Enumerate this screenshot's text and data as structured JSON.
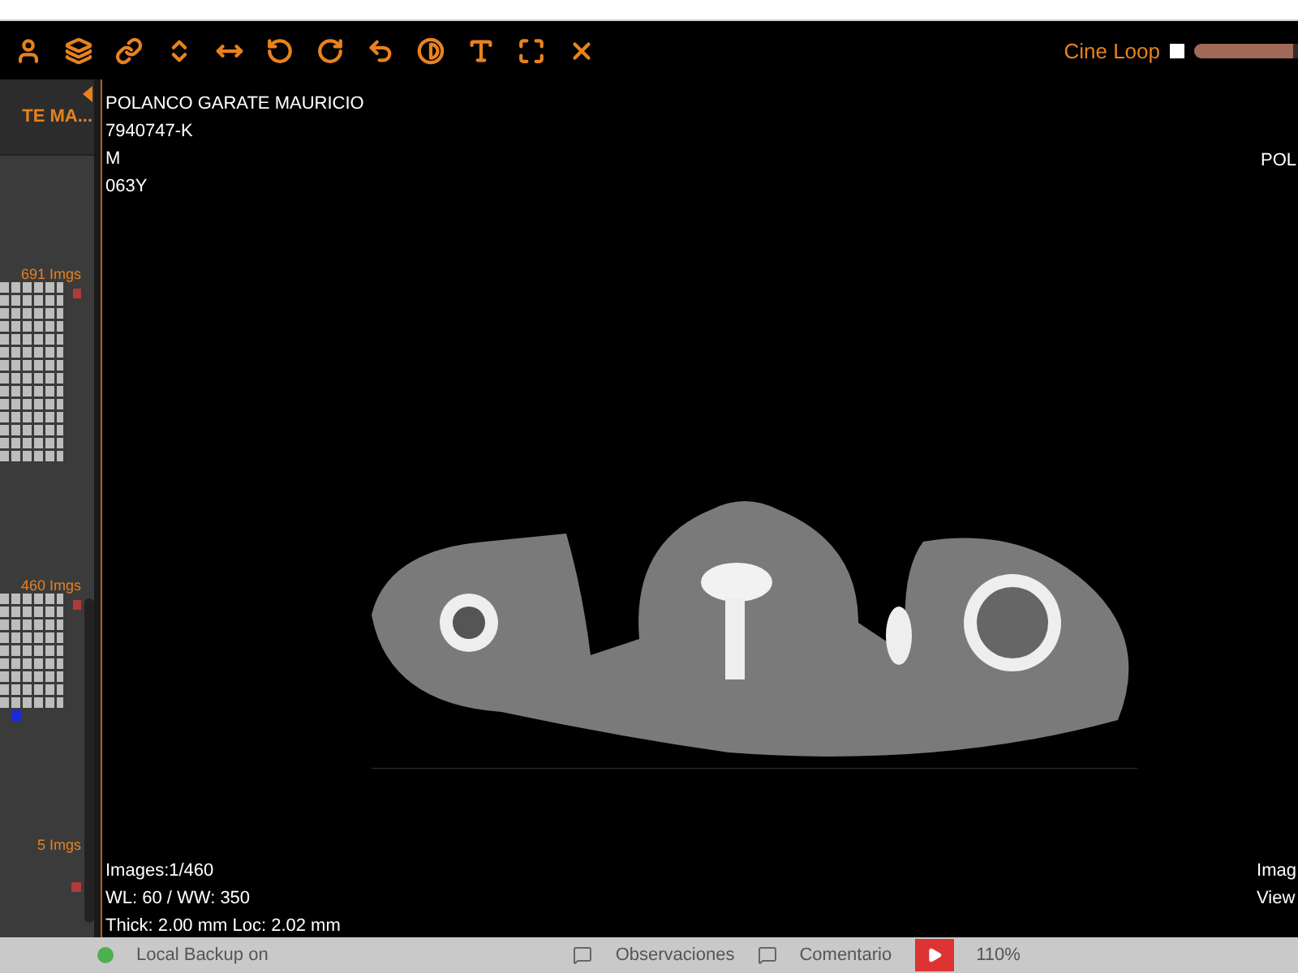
{
  "toolbar": {
    "tools": [
      {
        "kind": "person"
      },
      {
        "kind": "layers"
      },
      {
        "kind": "link"
      },
      {
        "kind": "vertical"
      },
      {
        "kind": "horizontal"
      },
      {
        "kind": "rotate-left"
      },
      {
        "kind": "rotate-right"
      },
      {
        "kind": "undo"
      },
      {
        "kind": "contrast"
      },
      {
        "kind": "text"
      },
      {
        "kind": "expand"
      },
      {
        "kind": "cross"
      }
    ],
    "cine_loop": {
      "label": "Cine Loop",
      "checked": false,
      "level": 0.95
    }
  },
  "sidebar": {
    "title": "TE MA...",
    "series": [
      {
        "count": "691 Imgs",
        "selected": false
      },
      {
        "count": "460 Imgs",
        "selected": true
      },
      {
        "count": "5 Imgs",
        "selected": false
      }
    ]
  },
  "viewer": {
    "patient": [
      "POLANCO GARATE MAURICIO",
      "7940747-K",
      "M",
      "063Y"
    ],
    "top_right": "POL",
    "bottom_left": [
      "Images:1/460",
      "WL: 60 / WW: 350",
      "Thick: 2.00 mm Loc: 2.02 mm"
    ],
    "bottom_right": [
      "Imag",
      "View"
    ]
  },
  "status_bar": {
    "backup": "Local Backup on",
    "items": [
      "Observaciones",
      "Comentario"
    ],
    "zoom": "110%"
  }
}
